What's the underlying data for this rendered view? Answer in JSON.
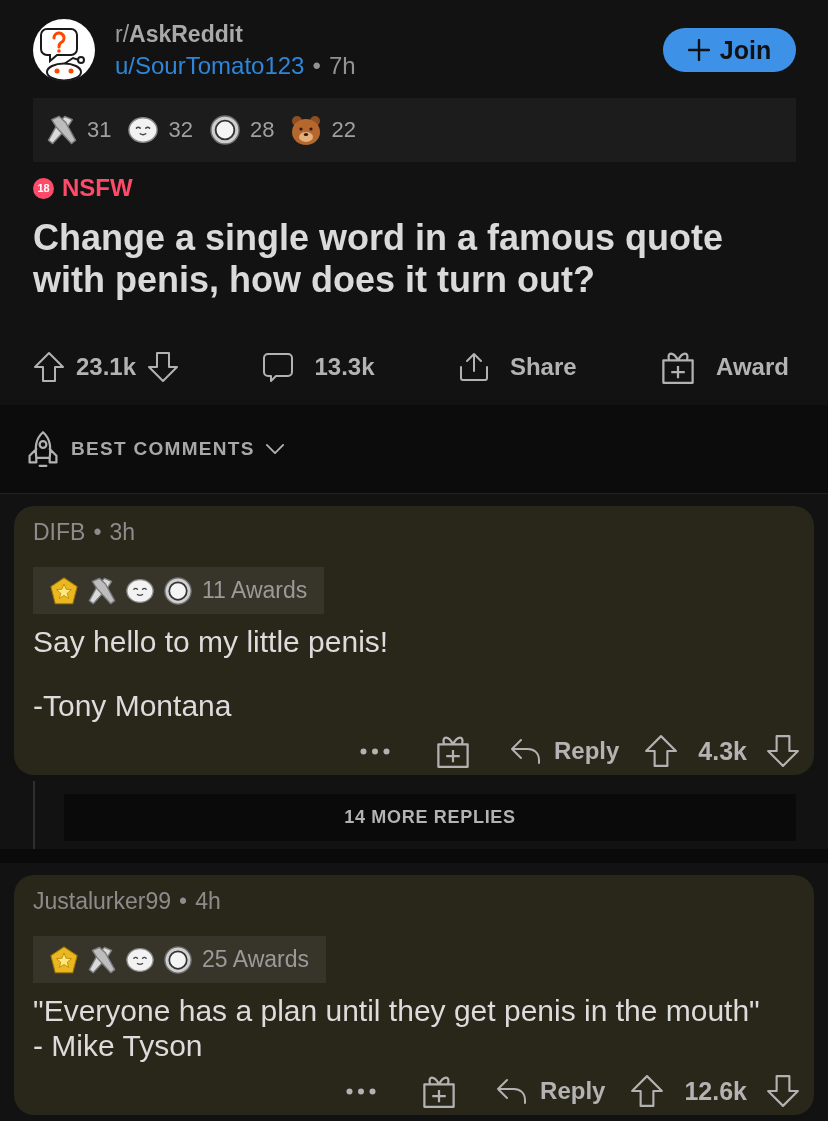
{
  "post": {
    "subreddit": "r/**AskReddit**",
    "author": "u/SourTomato123",
    "separator": "•",
    "age": "7h",
    "join_label": "Join",
    "awards": [
      {
        "kind": "handshake",
        "count": "31"
      },
      {
        "kind": "blob",
        "count": "32"
      },
      {
        "kind": "coin",
        "count": "28"
      },
      {
        "kind": "bear",
        "count": "22"
      }
    ],
    "nsfw": {
      "badge": "18",
      "label": "NSFW"
    },
    "title": "Change a single word in a famous quote with penis, how does it turn out?",
    "actions": {
      "votes": "23.1k",
      "comments": "13.3k",
      "share": "Share",
      "award": "Award"
    }
  },
  "sort": {
    "label": "BEST COMMENTS"
  },
  "comments": [
    {
      "author": "DIFB",
      "separator": "•",
      "age": "3h",
      "awards": [
        {
          "kind": "star"
        },
        {
          "kind": "handshake"
        },
        {
          "kind": "blob"
        },
        {
          "kind": "coin"
        }
      ],
      "awards_label": "11 Awards",
      "paragraphs": [
        "Say hello to my little penis!",
        "-Tony Montana"
      ],
      "reply": "Reply",
      "votes": "4.3k",
      "more_replies": "14 MORE REPLIES"
    },
    {
      "author": "Justalurker99",
      "separator": "•",
      "age": "4h",
      "awards": [
        {
          "kind": "star"
        },
        {
          "kind": "handshake"
        },
        {
          "kind": "blob"
        },
        {
          "kind": "coin"
        }
      ],
      "awards_label": "25 Awards",
      "paragraphs": [
        "\"Everyone has a plan until they get penis in the mouth\"\n- Mike Tyson"
      ],
      "reply": "Reply",
      "votes": "12.6k"
    }
  ]
}
